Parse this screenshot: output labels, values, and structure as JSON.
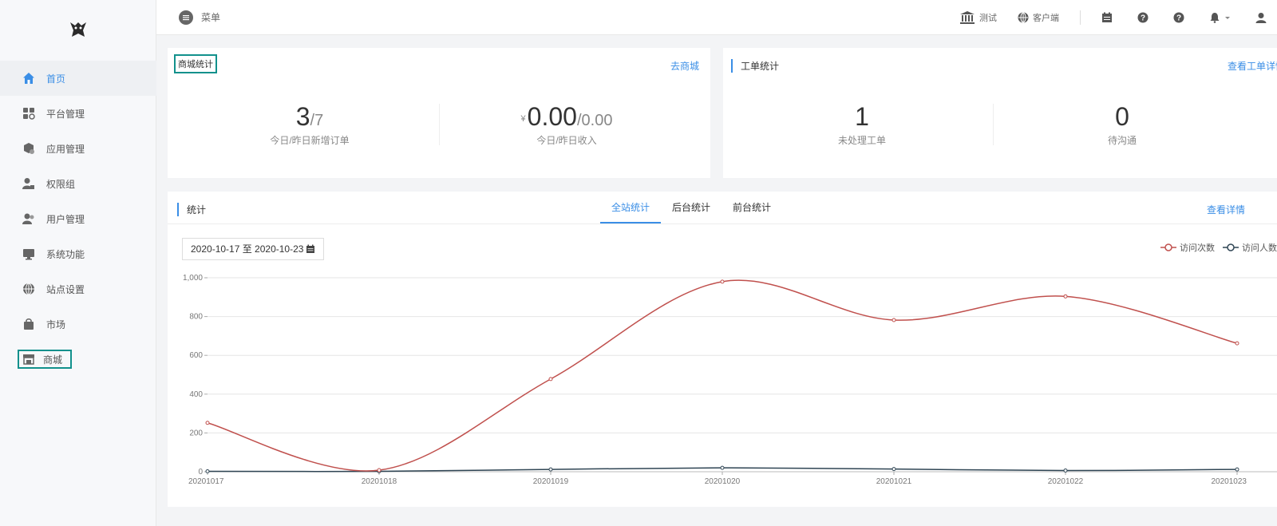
{
  "topbar": {
    "menu_label": "菜单",
    "items": [
      {
        "label": "测试",
        "icon": "bank-icon"
      },
      {
        "label": "客户端",
        "icon": "globe-icon"
      }
    ],
    "icons": [
      "calendar-icon",
      "help-icon",
      "help-icon",
      "bell-icon",
      "user-icon"
    ]
  },
  "sidebar": {
    "items": [
      {
        "label": "首页",
        "icon": "home-icon",
        "active": true
      },
      {
        "label": "平台管理",
        "icon": "grid-icon"
      },
      {
        "label": "应用管理",
        "icon": "box-icon"
      },
      {
        "label": "权限组",
        "icon": "user-lock-icon"
      },
      {
        "label": "用户管理",
        "icon": "users-icon"
      },
      {
        "label": "系统功能",
        "icon": "monitor-icon"
      },
      {
        "label": "站点设置",
        "icon": "globe-icon"
      },
      {
        "label": "市场",
        "icon": "bag-icon"
      },
      {
        "label": "商城",
        "icon": "store-icon"
      }
    ]
  },
  "shop_card": {
    "title": "商城统计",
    "link": "去商城",
    "orders_today": "3",
    "orders_yesterday": "/7",
    "orders_caption": "今日/昨日新增订单",
    "currency": "¥",
    "income_today": "0.00",
    "income_yesterday": "/0.00",
    "income_caption": "今日/昨日收入"
  },
  "ticket_card": {
    "title": "工单统计",
    "link": "查看工单详情",
    "pending": "1",
    "pending_caption": "未处理工单",
    "to_contact": "0",
    "to_contact_caption": "待沟通"
  },
  "stats_card": {
    "title": "统计",
    "tabs": [
      "全站统计",
      "后台统计",
      "前台统计"
    ],
    "active_tab": 0,
    "link": "查看详情",
    "date_range": "2020-10-17 至 2020-10-23"
  },
  "chart_data": {
    "type": "line",
    "categories": [
      "20201017",
      "20201018",
      "20201019",
      "20201020",
      "20201021",
      "20201022",
      "20201023"
    ],
    "series": [
      {
        "name": "访问次数",
        "values": [
          252,
          8,
          478,
          980,
          782,
          904,
          662
        ],
        "color": "#c0504d"
      },
      {
        "name": "访问人数",
        "values": [
          2,
          2,
          12,
          20,
          14,
          6,
          12
        ],
        "color": "#2f4554"
      }
    ],
    "y_ticks": [
      "0",
      "200",
      "400",
      "600",
      "800",
      "1,000"
    ],
    "ylim": [
      0,
      1000
    ],
    "grid": true,
    "legend": "top-right"
  }
}
